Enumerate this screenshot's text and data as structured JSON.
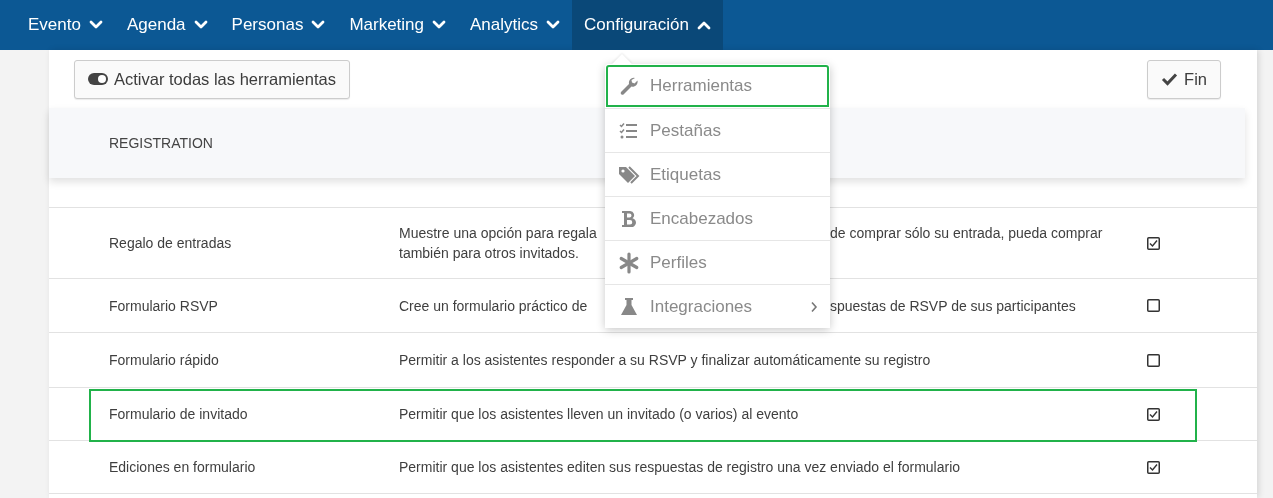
{
  "nav": [
    {
      "label": "Evento",
      "expanded": false
    },
    {
      "label": "Agenda",
      "expanded": false
    },
    {
      "label": "Personas",
      "expanded": false
    },
    {
      "label": "Marketing",
      "expanded": false
    },
    {
      "label": "Analytics",
      "expanded": false
    },
    {
      "label": "Configuración",
      "expanded": true
    }
  ],
  "toolbar": {
    "toggle_all_button": "Activar todas las herramientas",
    "done_button": "Fin"
  },
  "table": {
    "section_header": "REGISTRATION",
    "rows": [
      {
        "name": "Regalo de entradas",
        "description_lines": [
          [
            "Muestre una opción para regala",
            "de comprar sólo su entrada, pueda comprar"
          ],
          [
            "también para otros invitados."
          ]
        ],
        "checked": true,
        "highlighted": false
      },
      {
        "name": "Formulario RSVP",
        "description_lines": [
          [
            "Cree un formulario práctico de",
            "spuestas de RSVP de sus participantes"
          ]
        ],
        "checked": false,
        "highlighted": false
      },
      {
        "name": "Formulario rápido",
        "description_lines": [
          [
            "Permitir a los asistentes responder a su RSVP y finalizar automáticamente su registro"
          ]
        ],
        "checked": false,
        "highlighted": false
      },
      {
        "name": "Formulario de invitado",
        "description_lines": [
          [
            "Permitir que los asistentes lleven un invitado (o varios) al evento"
          ]
        ],
        "checked": true,
        "highlighted": true
      },
      {
        "name": "Ediciones en formulario",
        "description_lines": [
          [
            "Permitir que los asistentes editen sus respuestas de registro una vez enviado el formulario"
          ]
        ],
        "checked": true,
        "highlighted": false
      }
    ]
  },
  "menu": {
    "items": [
      {
        "label": "Herramientas",
        "highlighted": true,
        "has_submenu": false
      },
      {
        "label": "Pestañas",
        "highlighted": false,
        "has_submenu": false
      },
      {
        "label": "Etiquetas",
        "highlighted": false,
        "has_submenu": false
      },
      {
        "label": "Encabezados",
        "highlighted": false,
        "has_submenu": false
      },
      {
        "label": "Perfiles",
        "highlighted": false,
        "has_submenu": false
      },
      {
        "label": "Integraciones",
        "highlighted": false,
        "has_submenu": true
      }
    ]
  }
}
